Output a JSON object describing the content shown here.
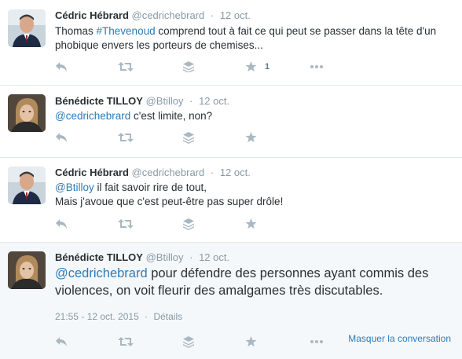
{
  "tweets": [
    {
      "name": "Cédric Hébrard",
      "handle": "@cedrichebrard",
      "time": "12 oct.",
      "text_plain_1": "Thomas ",
      "text_link_1": "#Thevenoud",
      "text_plain_2": " comprend tout à fait ce qui peut se passer dans la tête d'un phobique envers les porteurs de chemises...",
      "favorite_count": "1"
    },
    {
      "name": "Bénédicte TILLOY",
      "handle": "@Btilloy",
      "time": "12 oct.",
      "text_link_1": "@cedrichebrard",
      "text_plain_1": " c'est limite, non?"
    },
    {
      "name": "Cédric Hébrard",
      "handle": "@cedrichebrard",
      "time": "12 oct.",
      "text_link_1": "@Btilloy",
      "text_plain_1": " il fait savoir rire de tout,",
      "text_line_2": "Mais j'avoue que c'est peut-être pas super drôle!"
    },
    {
      "name": "Bénédicte TILLOY",
      "handle": "@Btilloy",
      "time": "12 oct.",
      "text_link_1": "@cedrichebrard",
      "text_plain_1": " pour défendre des personnes ayant commis des violences, on voit fleurir des amalgames très discutables.",
      "timestamp": "21:55 - 12 oct. 2015",
      "details": "Détails",
      "hide_conversation": "Masquer la conversation"
    }
  ],
  "colors": {
    "link": "#2b7bb9",
    "icon": "#aab8c2",
    "name": "#292f33",
    "muted": "#8899a6",
    "focused_bg": "#f5f8fa"
  },
  "icons": [
    "reply-icon",
    "retweet-icon",
    "stack-icon",
    "favorite-star-icon",
    "more-dots-icon"
  ]
}
